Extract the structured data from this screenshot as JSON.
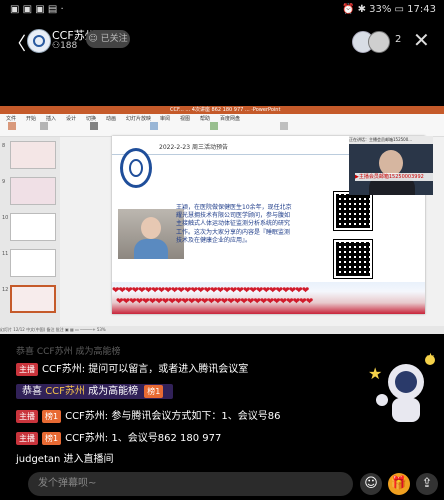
{
  "status": {
    "left_icons": "▣ ▣ ▣ ▤ ·",
    "right_text": "⏰ ✱ 33% ▭ 17:43"
  },
  "header": {
    "channel_name": "CCF苏州",
    "viewers": "⚇188",
    "follow_label": "☺ 已关注",
    "audience_count": "2",
    "close_glyph": "✕",
    "back_glyph": "〈"
  },
  "ppt": {
    "title": "CCF... ... 4次讲座 862 180 977 ... ·PowerPoint",
    "tabs": [
      "文件",
      "开始",
      "插入",
      "设计",
      "切换",
      "动画",
      "幻灯片放映",
      "审阅",
      "视图",
      "帮助",
      "百度网盘"
    ],
    "thumb_numbers": [
      "8",
      "9",
      "10",
      "11",
      "12"
    ],
    "slide": {
      "date_line": "2022-2-23 周三活动预告",
      "body": "王颖，在医院做保健医生10余年，现任北京耀光慧拥技术有限公司医学顾问，参与腹如主接触式人体运动体征监测分析系统的研究工作。这次为大家分享的内容是『睡眠监测技术及在健康企业的应用』。",
      "heart_row": "❤❤❤❤❤❤❤❤❤❤❤❤❤❤❤❤❤❤❤❤❤❤❤❤❤❤❤❤❤❤"
    },
    "webcam": {
      "bar_text": "正在讲话：主播会员邮箱152500...",
      "label": "▶主播会员邮箱15250003992"
    },
    "statusbar": "幻灯片 12/12    中文(中国)    备注    批注                                      ▣  ▦  ▭   ─────+  53%"
  },
  "chat": {
    "faded_line": "恭喜 CCF苏州 成为高能榜",
    "messages": [
      {
        "badges": [
          "主播"
        ],
        "text": "CCF苏州: 提问可以留言，或者进入腾讯会议室"
      },
      {
        "congrats_prefix": "恭喜",
        "name": "CCF苏州",
        "suffix": "成为高能榜",
        "level": "榜1"
      },
      {
        "badges": [
          "主播",
          "榜1"
        ],
        "text": "CCF苏州: 参与腾讯会议方式如下：1、会议号86"
      },
      {
        "badges": [
          "主播",
          "榜1"
        ],
        "text": "CCF苏州: 1、会议号862 180 977"
      },
      {
        "text": "judgetan 进入直播间"
      }
    ]
  },
  "bottom": {
    "placeholder": "发个弹幕呗~",
    "icons": [
      "emoji-icon",
      "gift-icon",
      "share-icon"
    ]
  },
  "colors": {
    "host_badge": "#c9343c",
    "level_badge": "#e86a33",
    "ppt_accent": "#c55a2a",
    "gold": "#f5c34a"
  }
}
